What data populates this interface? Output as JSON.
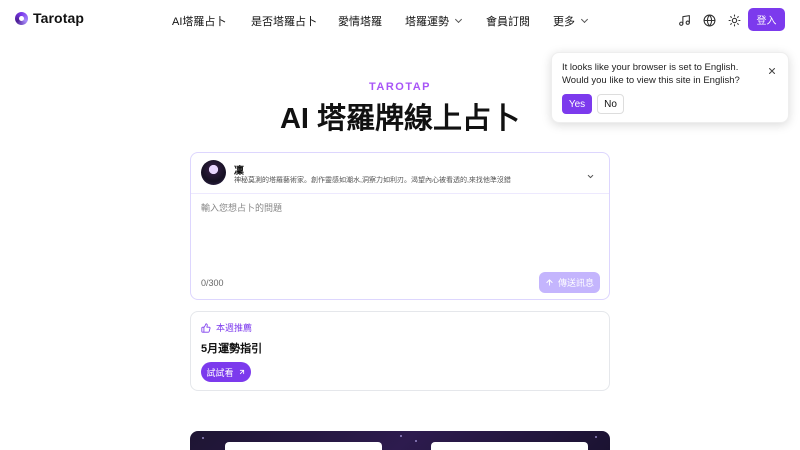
{
  "app": {
    "name": "Tarotap"
  },
  "nav": {
    "items": [
      {
        "label": "AI塔羅占卜"
      },
      {
        "label": "是否塔羅占卜"
      },
      {
        "label": "愛情塔羅"
      },
      {
        "label": "塔羅運勢"
      },
      {
        "label": "會員訂閱"
      },
      {
        "label": "更多"
      }
    ],
    "login_label": "登入"
  },
  "hero": {
    "tag": "TAROTAP",
    "title": "AI 塔羅牌線上占卜"
  },
  "chat": {
    "reader": {
      "name": "凜",
      "description": "神秘莫測的塔羅藝術家。創作靈感如潮水,洞察力如利刃。渴望內心被看透的,來找他準沒錯"
    },
    "input_placeholder": "輸入您想占卜的問題",
    "char_count": "0/300",
    "send_label": "傳送訊息"
  },
  "recommend": {
    "label": "本週推薦",
    "title": "5月運勢指引",
    "try_label": "試試看"
  },
  "lang_popup": {
    "message": "It looks like your browser is set to English. Would you like to view this site in English?",
    "yes_label": "Yes",
    "no_label": "No"
  },
  "colors": {
    "accent": "#7c3aed",
    "accent_light": "#c4b5fd",
    "tag": "#a855f7"
  }
}
